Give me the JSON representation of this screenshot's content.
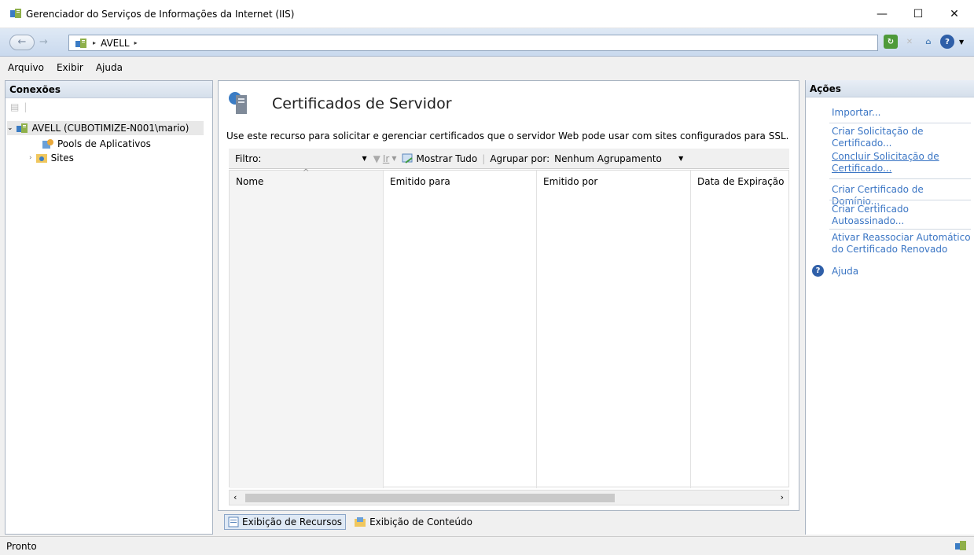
{
  "window": {
    "title": "Gerenciador do Serviços de Informações da Internet (IIS)",
    "minimize": "—",
    "maximize": "☐",
    "close": "✕"
  },
  "address": {
    "crumbs": [
      "AVELL"
    ],
    "sep": "▸"
  },
  "menu": [
    "Arquivo",
    "Exibir",
    "Ajuda"
  ],
  "connections": {
    "title": "Conexões",
    "tree": [
      {
        "label": "AVELL (CUBOTIMIZE-N001\\mario)",
        "level": 0,
        "expanded": true,
        "icon": "server-icon"
      },
      {
        "label": "Pools de Aplicativos",
        "level": 1,
        "icon": "app-pool-icon"
      },
      {
        "label": "Sites",
        "level": 1,
        "expanded": false,
        "icon": "sites-folder-icon"
      }
    ]
  },
  "feature": {
    "title": "Certificados de Servidor",
    "description": "Use este recurso para solicitar e gerenciar certificados que o servidor Web pode usar com sites configurados para SSL.",
    "filter_label": "Filtro:",
    "go_label": "Ir",
    "show_all_label": "Mostrar Tudo",
    "group_by_label": "Agrupar por:",
    "group_by_value": "Nenhum Agrupamento",
    "columns": [
      "Nome",
      "Emitido para",
      "Emitido por",
      "Data de Expiração"
    ],
    "tabs": [
      "Exibição de Recursos",
      "Exibição de Conteúdo"
    ]
  },
  "actions": {
    "title": "Ações",
    "items": [
      {
        "label": "Importar..."
      },
      {
        "label": "Criar Solicitação de Certificado..."
      },
      {
        "label": "Concluir Solicitação de Certificado..."
      },
      {
        "label": "Criar Certificado de Domínio..."
      },
      {
        "label": "Criar Certificado Autoassinado..."
      },
      {
        "label": "Ativar Reassociar Automático do Certificado Renovado"
      }
    ],
    "help": "Ajuda"
  },
  "status": {
    "text": "Pronto"
  },
  "colors": {
    "link": "#3a75c4",
    "pane_border": "#a9b4c2",
    "address_bg": "#c9d9ee"
  }
}
